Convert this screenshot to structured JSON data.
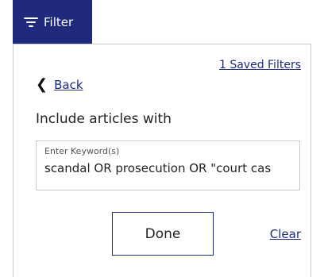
{
  "filter_tab": {
    "label": "Filter",
    "icon": "filter-lines-icon",
    "background": "#1f2a7c"
  },
  "panel": {
    "saved_filters_link": "1 Saved Filters",
    "back_link": "Back",
    "section_title": "Include articles with",
    "keyword_field": {
      "label": "Enter Keyword(s)",
      "value": "scandal OR prosecution OR \"court cas"
    },
    "done_button": "Done",
    "clear_link": "Clear"
  },
  "colors": {
    "accent": "#1f2a7c",
    "text": "#222222",
    "border": "#c8c8c8"
  }
}
